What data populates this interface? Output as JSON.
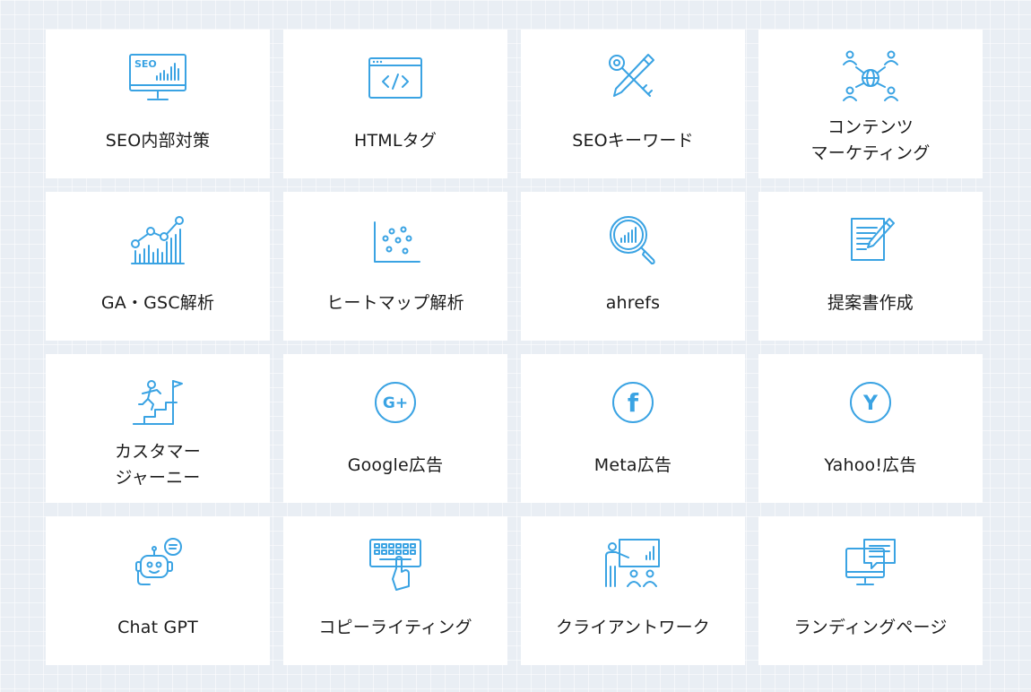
{
  "cards": [
    {
      "label": "SEO内部対策",
      "icon": "seo-monitor-icon"
    },
    {
      "label": "HTMLタグ",
      "icon": "code-window-icon"
    },
    {
      "label": "SEOキーワード",
      "icon": "key-pencil-icon"
    },
    {
      "label": "コンテンツ\nマーケティング",
      "icon": "network-people-icon"
    },
    {
      "label": "GA・GSC解析",
      "icon": "line-chart-icon"
    },
    {
      "label": "ヒートマップ解析",
      "icon": "scatter-plot-icon"
    },
    {
      "label": "ahrefs",
      "icon": "magnifier-chart-icon"
    },
    {
      "label": "提案書作成",
      "icon": "document-pen-icon"
    },
    {
      "label": "カスタマー\nジャーニー",
      "icon": "stairs-goal-icon"
    },
    {
      "label": "Google広告",
      "icon": "google-plus-icon"
    },
    {
      "label": "Meta広告",
      "icon": "facebook-icon"
    },
    {
      "label": "Yahoo!広告",
      "icon": "yahoo-icon"
    },
    {
      "label": "Chat GPT",
      "icon": "robot-chat-icon"
    },
    {
      "label": "コピーライティング",
      "icon": "keyboard-hand-icon"
    },
    {
      "label": "クライアントワーク",
      "icon": "presentation-icon"
    },
    {
      "label": "ランディングページ",
      "icon": "monitor-chat-icon"
    }
  ],
  "icon_text": {
    "seo": "SEO",
    "google_plus": "G+",
    "facebook": "f",
    "yahoo": "Y"
  },
  "colors": {
    "accent": "#3aa3e3",
    "background": "#e9eef4",
    "card": "#ffffff",
    "text": "#1b1b1b"
  }
}
